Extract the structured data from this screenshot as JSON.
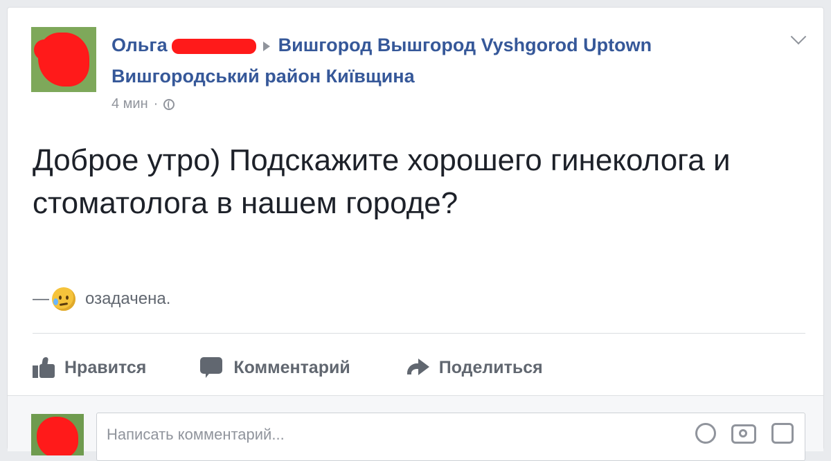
{
  "post": {
    "author_first_name": "Ольга",
    "location": "Вишгород Вышгород Vyshgorod Uptown Вишгородський район Київщина",
    "time": "4 мин",
    "separator": "·",
    "privacy_icon": "globe-icon",
    "text": "Доброе утро) Подскажите хорошего гинеколога и стоматолога в нашем городе?",
    "feeling_prefix": "—",
    "feeling_text": "озадачена."
  },
  "actions": {
    "like_label": "Нравится",
    "comment_label": "Комментарий",
    "share_label": "Поделиться"
  },
  "comment_input": {
    "placeholder": "Написать комментарий..."
  },
  "colors": {
    "link": "#365899",
    "redaction": "#ff1a1a",
    "muted": "#90949c",
    "action_text": "#616770"
  }
}
